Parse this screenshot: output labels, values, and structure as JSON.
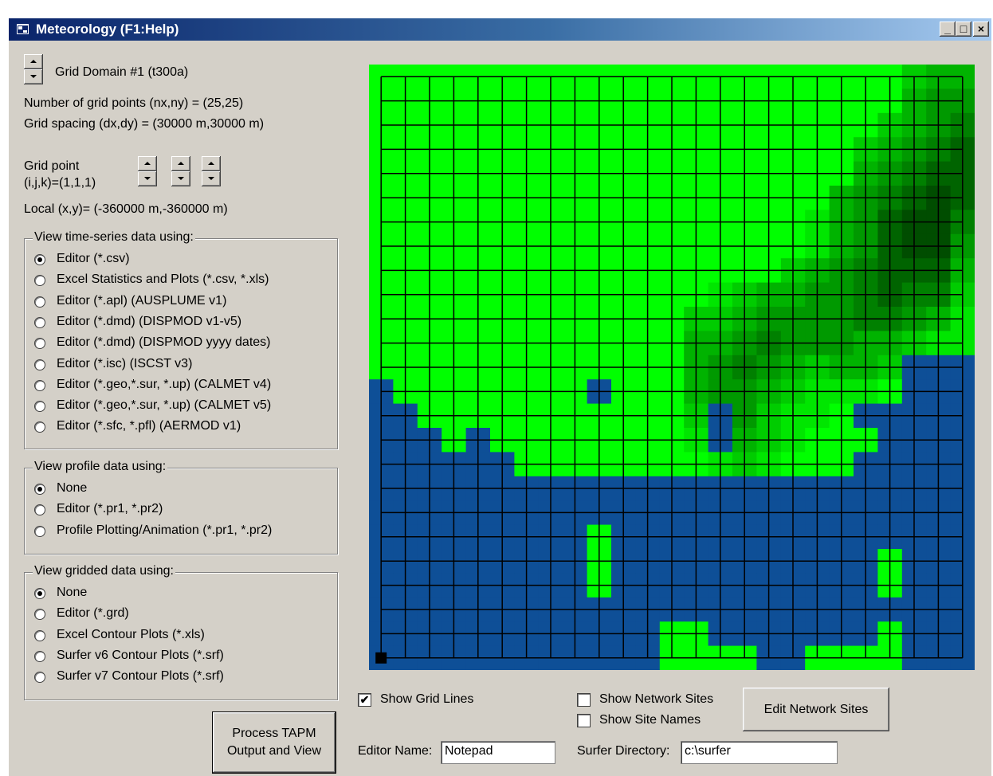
{
  "window": {
    "title": "Meteorology (F1:Help)",
    "minimize": "_",
    "maximize": "□",
    "close": "×"
  },
  "domain": {
    "label": "Grid Domain #1 (t300a)"
  },
  "info": {
    "grid_points": "Number of grid points (nx,ny) = (25,25)",
    "grid_spacing": "Grid spacing (dx,dy) = (30000 m,30000 m)",
    "grid_point_label_1": "Grid point",
    "grid_point_label_2": "(i,j,k)=(1,1,1)",
    "local_xy": "Local (x,y)= (-360000 m,-360000 m)"
  },
  "timeseries": {
    "title": "View time-series data using:",
    "options": [
      {
        "label": "Editor (*.csv)",
        "selected": true
      },
      {
        "label": "Excel Statistics and Plots (*.csv, *.xls)",
        "selected": false
      },
      {
        "label": "Editor (*.apl) (AUSPLUME v1)",
        "selected": false
      },
      {
        "label": "Editor (*.dmd) (DISPMOD v1-v5)",
        "selected": false
      },
      {
        "label": "Editor (*.dmd) (DISPMOD yyyy dates)",
        "selected": false
      },
      {
        "label": "Editor (*.isc) (ISCST v3)",
        "selected": false
      },
      {
        "label": "Editor (*.geo,*.sur, *.up) (CALMET v4)",
        "selected": false
      },
      {
        "label": "Editor (*.geo,*.sur, *.up) (CALMET v5)",
        "selected": false
      },
      {
        "label": "Editor (*.sfc, *.pfl) (AERMOD v1)",
        "selected": false
      }
    ]
  },
  "profile": {
    "title": "View profile data using:",
    "options": [
      {
        "label": "None",
        "selected": true
      },
      {
        "label": "Editor (*.pr1, *.pr2)",
        "selected": false
      },
      {
        "label": "Profile Plotting/Animation (*.pr1, *.pr2)",
        "selected": false
      }
    ]
  },
  "gridded": {
    "title": "View gridded data using:",
    "options": [
      {
        "label": "None",
        "selected": true
      },
      {
        "label": "Editor (*.grd)",
        "selected": false
      },
      {
        "label": "Excel Contour Plots (*.xls)",
        "selected": false
      },
      {
        "label": "Surfer v6 Contour Plots (*.srf)",
        "selected": false
      },
      {
        "label": "Surfer v7 Contour Plots (*.srf)",
        "selected": false
      }
    ]
  },
  "process_button": {
    "line1": "Process TAPM",
    "line2": "Output and View"
  },
  "controls": {
    "show_grid_lines": {
      "label": "Show Grid Lines",
      "checked": true
    },
    "show_network_sites": {
      "label": "Show Network Sites",
      "checked": false
    },
    "show_site_names": {
      "label": "Show Site Names",
      "checked": false
    },
    "edit_network_sites": "Edit Network Sites",
    "editor_name_label": "Editor Name:",
    "editor_name_value": "Notepad",
    "surfer_dir_label": "Surfer Directory:",
    "surfer_dir_value": "c:\\surfer",
    "check_mark": "✔"
  },
  "map": {
    "nx": 25,
    "ny": 25,
    "selected_point": [
      1,
      1
    ],
    "colors": {
      "water": "#0e4f97",
      "land_levels": [
        "#00ff00",
        "#00e600",
        "#00cc00",
        "#00b300",
        "#009900",
        "#008000",
        "#006400",
        "#004d00"
      ],
      "grid_line": "#000000",
      "marker": "#000000"
    },
    "land_mask": [
      "1111111111111111111111111",
      "1111111111111111111111111",
      "1111111111111111111111111",
      "1111111111111111111111111",
      "1111111111111111111111111",
      "1111111111111111111111111",
      "1111111111111111111111111",
      "1111111111111111111111111",
      "1111111111111111111111111",
      "1111111111111111111111111",
      "1111111111111111111111111",
      "1111111111111111111111111",
      "1111111111111111111111000",
      "0111111110111111111111000",
      "0011111111111101111100000",
      "0001011111111101111110000",
      "0000001111111111111100000",
      "0000000000000000000000000",
      "0000000000000000000000000",
      "0000000000000000000000000",
      "0000000000000000000000000",
      "0000000000000000000000000",
      "0000000000000000000000000",
      "0000000000000000000000000",
      "0000000000000000000000000"
    ],
    "elevation": [
      "0000000000000000000000233",
      "0000000000000000000000344",
      "0000000000000000000002345",
      "0000000000000000000023456",
      "0000000000000000000034566",
      "0000000000000000000345676",
      "0000000000000000001346775",
      "0000000000000000001346774",
      "0000000000000000023456663",
      "0000000000000012334456552",
      "0000000000000223444455431",
      "0000000000000334544433211",
      "0000000000000345432332000",
      "0000000000000344321110000",
      "0000000000000234211000000",
      "0000000000000123210000000",
      "0000000000000012100000000",
      "0000000000000000000000000",
      "0000000000000000000000000",
      "0000000000000000000000000",
      "0000000000000000000000000",
      "0000000000000000000000000",
      "0000000000000000000000000",
      "0000000000000000000000000",
      "0000000000000000000000000"
    ],
    "extra_land": [
      [
        13,
        0
      ],
      [
        13,
        1
      ],
      [
        14,
        2
      ],
      [
        14,
        3
      ],
      [
        14,
        4
      ],
      [
        15,
        5
      ],
      [
        15,
        6
      ],
      [
        15,
        7
      ],
      [
        15,
        8
      ],
      [
        15,
        9
      ],
      [
        15,
        10
      ],
      [
        15,
        11
      ],
      [
        16,
        12
      ],
      [
        16,
        13
      ],
      [
        16,
        14
      ],
      [
        16,
        15
      ],
      [
        16,
        16
      ],
      [
        16,
        17
      ],
      [
        16,
        18
      ],
      [
        16,
        19
      ],
      [
        16,
        20
      ],
      [
        16,
        21
      ],
      [
        16,
        22
      ],
      [
        16,
        23
      ],
      [
        16,
        24
      ],
      [
        19,
        9
      ],
      [
        20,
        9
      ],
      [
        21,
        9
      ],
      [
        20,
        21
      ],
      [
        21,
        21
      ],
      [
        23,
        12
      ],
      [
        24,
        12
      ],
      [
        24,
        13
      ],
      [
        24,
        14
      ],
      [
        23,
        13
      ],
      [
        24,
        15
      ],
      [
        24,
        18
      ],
      [
        24,
        19
      ],
      [
        24,
        20
      ],
      [
        24,
        21
      ],
      [
        23,
        21
      ]
    ]
  }
}
